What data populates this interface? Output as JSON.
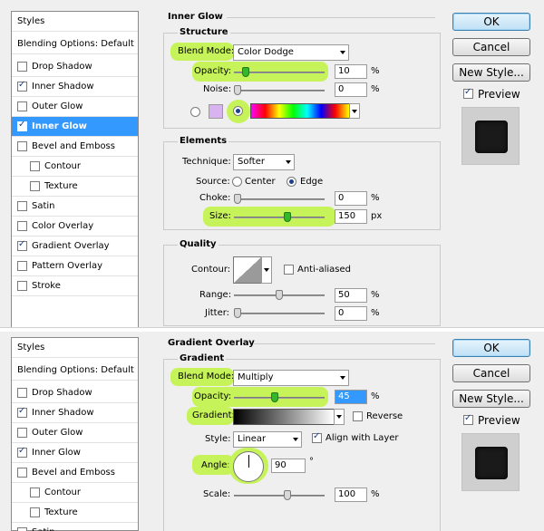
{
  "top": {
    "styles_header": "Styles",
    "blending_options": "Blending Options: Default",
    "items": [
      {
        "label": "Drop Shadow",
        "checked": false,
        "indent": false,
        "selected": false
      },
      {
        "label": "Inner Shadow",
        "checked": true,
        "indent": false,
        "selected": false
      },
      {
        "label": "Outer Glow",
        "checked": false,
        "indent": false,
        "selected": false
      },
      {
        "label": "Inner Glow",
        "checked": true,
        "indent": false,
        "selected": true
      },
      {
        "label": "Bevel and Emboss",
        "checked": false,
        "indent": false,
        "selected": false
      },
      {
        "label": "Contour",
        "checked": false,
        "indent": true,
        "selected": false
      },
      {
        "label": "Texture",
        "checked": false,
        "indent": true,
        "selected": false
      },
      {
        "label": "Satin",
        "checked": false,
        "indent": false,
        "selected": false
      },
      {
        "label": "Color Overlay",
        "checked": false,
        "indent": false,
        "selected": false
      },
      {
        "label": "Gradient Overlay",
        "checked": true,
        "indent": false,
        "selected": false
      },
      {
        "label": "Pattern Overlay",
        "checked": false,
        "indent": false,
        "selected": false
      },
      {
        "label": "Stroke",
        "checked": false,
        "indent": false,
        "selected": false
      }
    ],
    "section_title": "Inner Glow",
    "structure": {
      "title": "Structure",
      "blend_mode_label": "Blend Mode:",
      "blend_mode_value": "Color Dodge",
      "opacity_label": "Opacity:",
      "opacity_value": "10",
      "opacity_unit": "%",
      "opacity_fraction": 0.1,
      "noise_label": "Noise:",
      "noise_value": "0",
      "noise_unit": "%",
      "noise_fraction": 0.0
    },
    "elements": {
      "title": "Elements",
      "technique_label": "Technique:",
      "technique_value": "Softer",
      "source_label": "Source:",
      "source_center": "Center",
      "source_edge": "Edge",
      "choke_label": "Choke:",
      "choke_value": "0",
      "choke_unit": "%",
      "choke_fraction": 0.0,
      "size_label": "Size:",
      "size_value": "150",
      "size_unit": "px",
      "size_fraction": 0.6
    },
    "quality": {
      "title": "Quality",
      "contour_label": "Contour:",
      "antialiased_label": "Anti-aliased",
      "range_label": "Range:",
      "range_value": "50",
      "range_unit": "%",
      "range_fraction": 0.5,
      "jitter_label": "Jitter:",
      "jitter_value": "0",
      "jitter_unit": "%",
      "jitter_fraction": 0.0
    },
    "buttons": {
      "ok": "OK",
      "cancel": "Cancel",
      "new_style": "New Style...",
      "preview": "Preview"
    }
  },
  "bottom": {
    "styles_header": "Styles",
    "blending_options": "Blending Options: Default",
    "items": [
      {
        "label": "Drop Shadow",
        "checked": false,
        "indent": false,
        "selected": false
      },
      {
        "label": "Inner Shadow",
        "checked": true,
        "indent": false,
        "selected": false
      },
      {
        "label": "Outer Glow",
        "checked": false,
        "indent": false,
        "selected": false
      },
      {
        "label": "Inner Glow",
        "checked": true,
        "indent": false,
        "selected": false
      },
      {
        "label": "Bevel and Emboss",
        "checked": false,
        "indent": false,
        "selected": false
      },
      {
        "label": "Contour",
        "checked": false,
        "indent": true,
        "selected": false
      },
      {
        "label": "Texture",
        "checked": false,
        "indent": true,
        "selected": false
      },
      {
        "label": "Satin",
        "checked": false,
        "indent": false,
        "selected": false
      }
    ],
    "section_title": "Gradient Overlay",
    "gradient": {
      "title": "Gradient",
      "blend_mode_label": "Blend Mode:",
      "blend_mode_value": "Multiply",
      "opacity_label": "Opacity:",
      "opacity_value": "45",
      "opacity_unit": "%",
      "opacity_fraction": 0.45,
      "gradient_label": "Gradient:",
      "reverse_label": "Reverse",
      "style_label": "Style:",
      "style_value": "Linear",
      "align_label": "Align with Layer",
      "angle_label": "Angle:",
      "angle_value": "90",
      "angle_unit": "°",
      "scale_label": "Scale:",
      "scale_value": "100",
      "scale_unit": "%",
      "scale_fraction": 0.6
    },
    "buttons": {
      "ok": "OK",
      "cancel": "Cancel",
      "new_style": "New Style...",
      "preview": "Preview"
    }
  },
  "colors": {
    "highlight": "#c6f25a",
    "selection": "#3399ff",
    "glow_swatch": "#d9b3f0"
  }
}
